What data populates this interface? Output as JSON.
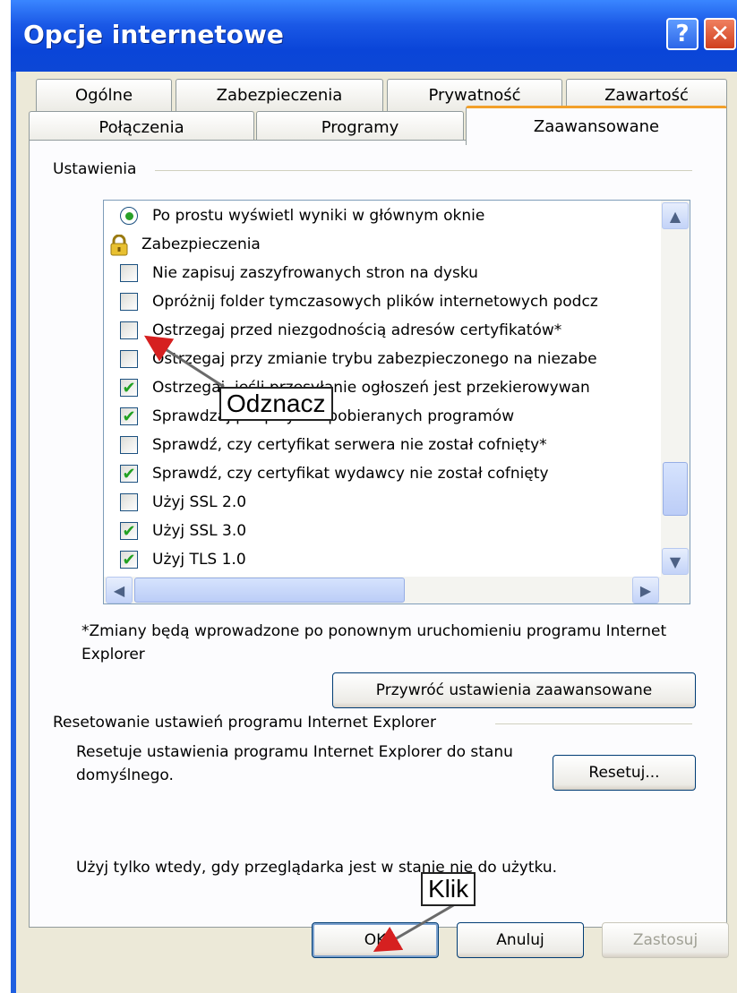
{
  "window": {
    "title": "Opcje internetowe",
    "help_glyph": "?",
    "close_glyph": "✕"
  },
  "tabs_back": [
    "Ogólne",
    "Zabezpieczenia",
    "Prywatność",
    "Zawartość"
  ],
  "tabs_front": [
    "Połączenia",
    "Programy",
    "Zaawansowane"
  ],
  "active_tab": "Zaawansowane",
  "settings": {
    "group_label": "Ustawienia",
    "items": [
      {
        "type": "radio",
        "checked": true,
        "label": "Po prostu wyświetl wyniki w głównym oknie"
      },
      {
        "type": "category",
        "icon": "lock-icon",
        "label": "Zabezpieczenia"
      },
      {
        "type": "checkbox",
        "checked": false,
        "label": "Nie zapisuj zaszyfrowanych stron na dysku"
      },
      {
        "type": "checkbox",
        "checked": false,
        "label": "Opróżnij folder tymczasowych plików internetowych podcz"
      },
      {
        "type": "checkbox",
        "checked": false,
        "label": "Ostrzegaj przed niezgodnością adresów certyfikatów*"
      },
      {
        "type": "checkbox",
        "checked": false,
        "label": "Ostrzegaj przy zmianie trybu zabezpieczonego na niezabe"
      },
      {
        "type": "checkbox",
        "checked": true,
        "label": "Ostrzegaj, jeśli przesyłanie ogłoszeń jest przekierowywan"
      },
      {
        "type": "checkbox",
        "checked": true,
        "label": "Sprawdzaj podpisy dla pobieranych programów"
      },
      {
        "type": "checkbox",
        "checked": false,
        "label": "Sprawdź, czy certyfikat serwera nie został cofnięty*"
      },
      {
        "type": "checkbox",
        "checked": true,
        "label": "Sprawdź, czy certyfikat wydawcy nie został cofnięty"
      },
      {
        "type": "checkbox",
        "checked": false,
        "label": "Użyj SSL 2.0"
      },
      {
        "type": "checkbox",
        "checked": true,
        "label": "Użyj SSL 3.0"
      },
      {
        "type": "checkbox",
        "checked": true,
        "label": "Użyj TLS 1.0"
      }
    ],
    "note": "*Zmiany będą wprowadzone po ponownym uruchomieniu programu Internet Explorer",
    "restore_button": "Przywróć ustawienia zaawansowane"
  },
  "reset": {
    "group_label": "Resetowanie ustawień programu Internet Explorer",
    "description": "Resetuje ustawienia programu Internet Explorer do stanu domyślnego.",
    "button": "Resetuj...",
    "note": "Użyj tylko wtedy, gdy przeglądarka jest w stanie nie do użytku."
  },
  "footer": {
    "ok": "OK",
    "cancel": "Anuluj",
    "apply": "Zastosuj"
  },
  "annotations": {
    "uncheck": "Odznacz",
    "click": "Klik"
  },
  "colors": {
    "title_bar": "#0a45d8",
    "dialog_bg": "#ece9d8",
    "panel_bg": "#fcfcfe",
    "check_green": "#21a121",
    "tab_highlight": "#f2a02a"
  }
}
